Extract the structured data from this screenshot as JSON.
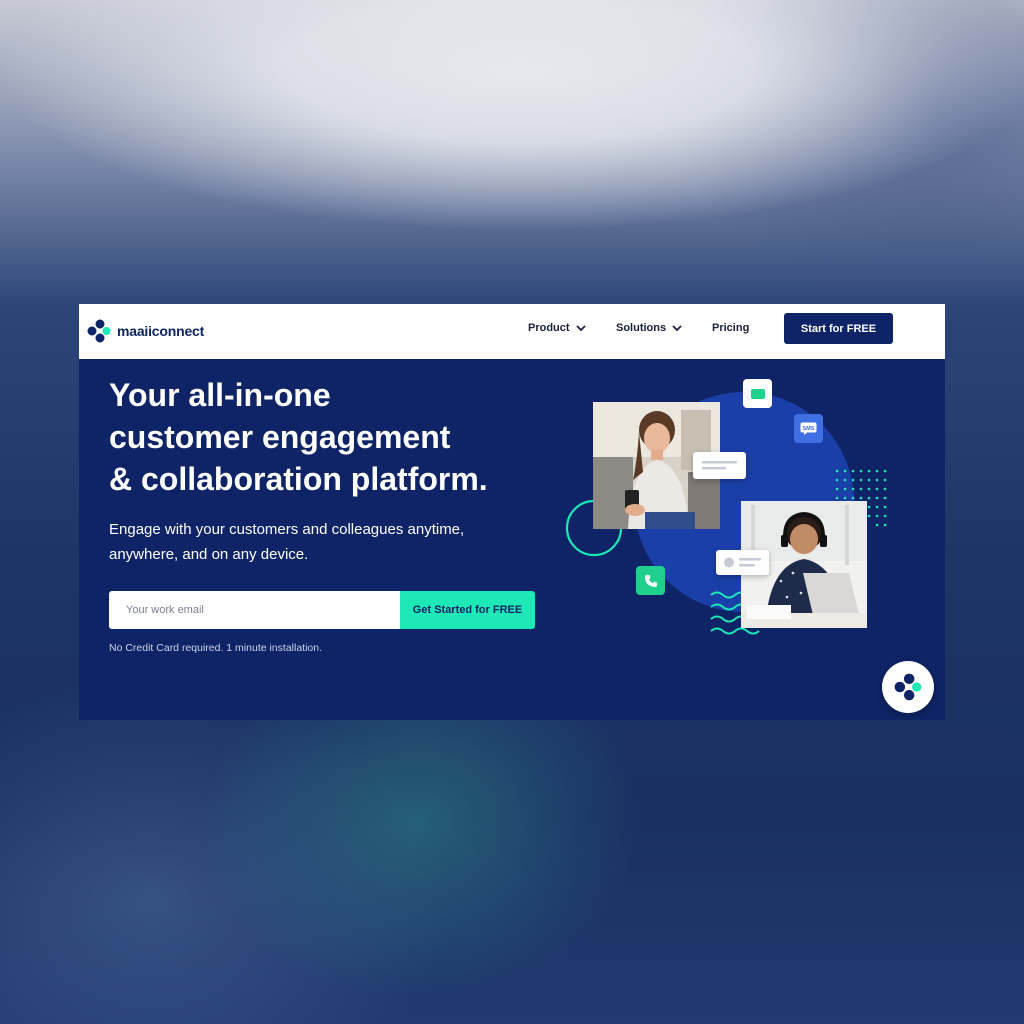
{
  "brand": {
    "name": "maaiiconnect"
  },
  "nav": {
    "items": [
      {
        "label": "Product",
        "has_dropdown": true
      },
      {
        "label": "Solutions",
        "has_dropdown": true
      },
      {
        "label": "Pricing",
        "has_dropdown": false
      }
    ],
    "cta_label": "Start for FREE"
  },
  "hero": {
    "headline_lines": [
      "Your all-in-one",
      "customer engagement",
      "& collaboration platform."
    ],
    "subtext_lines": [
      "Engage with your customers and colleagues anytime,",
      "anywhere, and on any device."
    ],
    "email_placeholder": "Your work email",
    "cta_label": "Get Started for FREE",
    "note": "No Credit Card required. 1 minute installation."
  },
  "illustration": {
    "sms_badge": "SMS",
    "icons": [
      "video-icon",
      "sms-icon",
      "phone-icon"
    ]
  },
  "colors": {
    "navy": "#0e2466",
    "accent": "#1de9b6",
    "blob": "#1a3fa8",
    "white": "#ffffff"
  }
}
